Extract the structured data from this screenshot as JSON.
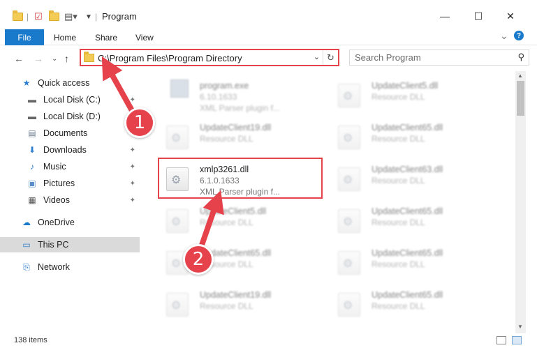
{
  "window": {
    "title": "Program",
    "minimize_glyph": "—",
    "maximize_glyph": "☐",
    "close_glyph": "✕"
  },
  "ribbon": {
    "tabs": [
      "File",
      "Home",
      "Share",
      "View"
    ],
    "expand_glyph": "⌄",
    "help_glyph": "?"
  },
  "address": {
    "path": "C:\\Program Files\\Program Directory",
    "refresh_glyph": "↻",
    "dropdown_glyph": "⌄"
  },
  "search": {
    "placeholder": "Search Program",
    "icon_glyph": "⚲"
  },
  "nav": {
    "back_glyph": "←",
    "forward_glyph": "→",
    "recent_glyph": "⌄",
    "up_glyph": "↑"
  },
  "sidebar": {
    "items": [
      {
        "label": "Quick access",
        "icon": "star-icon",
        "glyph": "★",
        "color": "#2b7fd3"
      },
      {
        "label": "Local Disk (C:)",
        "icon": "drive-icon",
        "glyph": "▬",
        "color": "#666666",
        "pinned": true
      },
      {
        "label": "Local Disk (D:)",
        "icon": "drive-icon",
        "glyph": "▬",
        "color": "#666666",
        "pinned": true
      },
      {
        "label": "Documents",
        "icon": "documents-icon",
        "glyph": "▤",
        "color": "#6e7f93",
        "pinned": true
      },
      {
        "label": "Downloads",
        "icon": "downloads-icon",
        "glyph": "⬇",
        "color": "#2b7fd3",
        "pinned": true
      },
      {
        "label": "Music",
        "icon": "music-icon",
        "glyph": "♪",
        "color": "#2b7fd3",
        "pinned": true
      },
      {
        "label": "Pictures",
        "icon": "pictures-icon",
        "glyph": "▣",
        "color": "#5a8cc8",
        "pinned": true
      },
      {
        "label": "Videos",
        "icon": "videos-icon",
        "glyph": "▦",
        "color": "#555555",
        "pinned": true
      },
      {
        "label": "OneDrive",
        "icon": "cloud-icon",
        "glyph": "☁",
        "color": "#1979ca"
      },
      {
        "label": "This PC",
        "icon": "computer-icon",
        "glyph": "▭",
        "color": "#2b7fd3",
        "selected": true
      },
      {
        "label": "Network",
        "icon": "network-icon",
        "glyph": "⎘",
        "color": "#2b7fd3"
      }
    ],
    "pin_glyph": "📌"
  },
  "files": {
    "left": [
      {
        "name": "program.exe",
        "line2": "6.10.1633",
        "line3": "XML Parser plugin f...",
        "kind": "exe"
      },
      {
        "name": "UpdateClient19.dll",
        "line2": "Resource DLL"
      },
      {
        "name": "xmlp3261.dll",
        "line2": "6.1.0.1633",
        "line3": "XML Parser plugin f...",
        "highlighted": true
      },
      {
        "name": "UpdateClient5.dll",
        "line2": "Resource DLL"
      },
      {
        "name": "UpdateClient65.dll",
        "line2": "Resource DLL"
      },
      {
        "name": "UpdateClient19.dll",
        "line2": "Resource DLL"
      }
    ],
    "right": [
      {
        "name": "UpdateClient5.dll",
        "line2": "Resource DLL"
      },
      {
        "name": "UpdateClient65.dll",
        "line2": "Resource DLL"
      },
      {
        "name": "UpdateClient63.dll",
        "line2": "Resource DLL"
      },
      {
        "name": "UpdateClient65.dll",
        "line2": "Resource DLL"
      },
      {
        "name": "UpdateClient65.dll",
        "line2": "Resource DLL"
      },
      {
        "name": "UpdateClient65.dll",
        "line2": "Resource DLL"
      }
    ]
  },
  "status": {
    "count": "138 items"
  },
  "annotations": {
    "badge1": "1",
    "badge2": "2",
    "color": "#e5424b"
  }
}
